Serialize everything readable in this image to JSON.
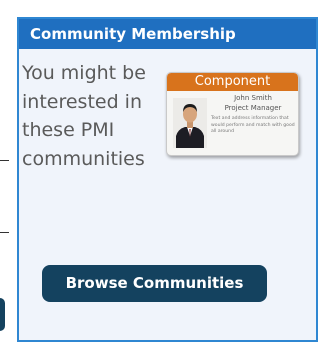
{
  "widget": {
    "title": "Community Membership",
    "body_text": "You might be interested in these PMI communities",
    "button_label": "Browse Communities"
  },
  "card": {
    "banner": "Component",
    "name": "John Smith",
    "role": "Project Manager",
    "description": "Text and address information that would perform and match with good all around"
  },
  "colors": {
    "header": "#1f6fc0",
    "widget_border": "#2f87d2",
    "widget_background": "#f0f4fb",
    "button": "#14425f",
    "card_banner": "#d8731c"
  }
}
